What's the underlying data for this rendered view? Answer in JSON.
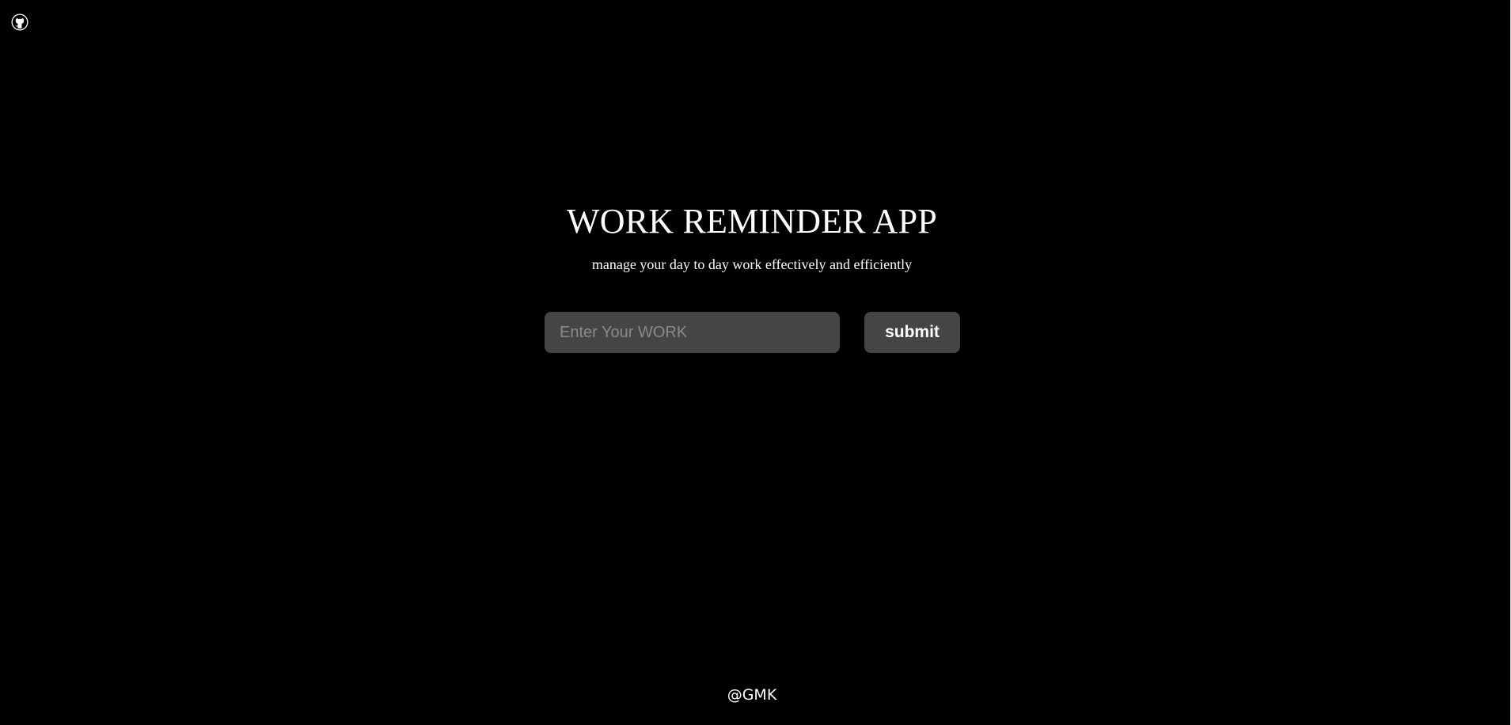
{
  "header": {
    "github_icon": "github-icon"
  },
  "main": {
    "title": "WORK REMINDER APP",
    "subtitle": "manage your day to day work effectively and efficiently",
    "work_input": {
      "placeholder": "Enter Your WORK",
      "value": ""
    },
    "submit_label": "submit"
  },
  "footer": {
    "credit": "@GMK"
  },
  "colors": {
    "background": "#000000",
    "text": "#ffffff",
    "control_bg": "#454545",
    "placeholder": "#8a8a8a"
  }
}
